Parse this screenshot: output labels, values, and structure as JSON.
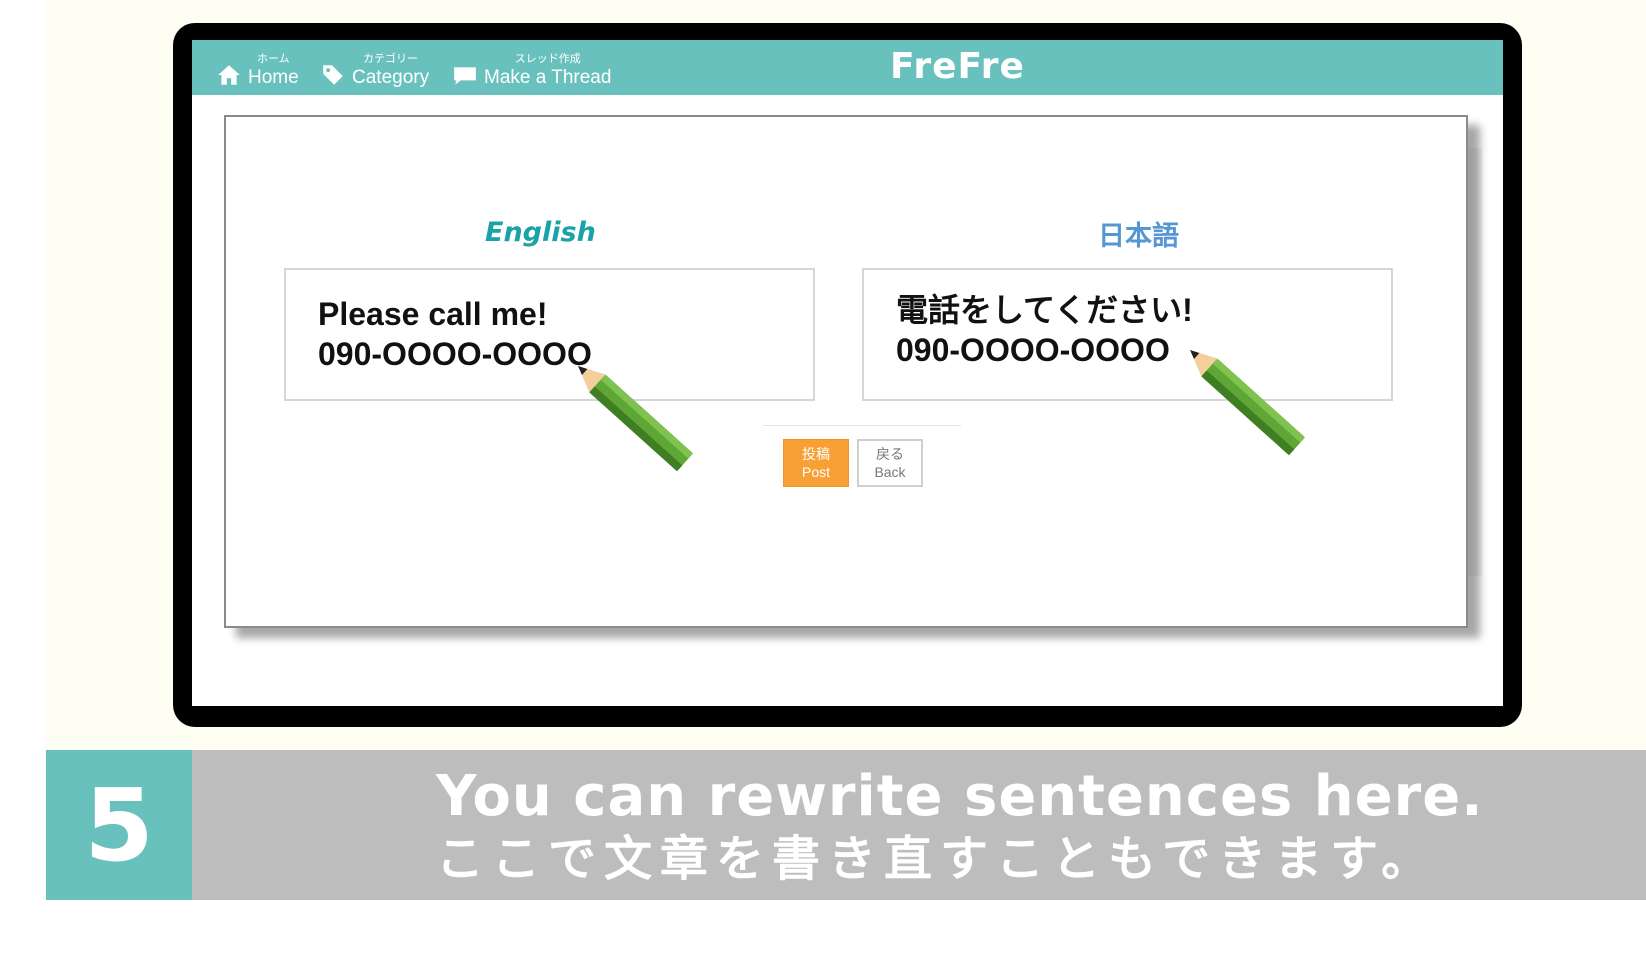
{
  "nav": {
    "home": {
      "jp": "ホーム",
      "en": "Home",
      "icon": "home-icon"
    },
    "category": {
      "jp": "カテゴリー",
      "en": "Category",
      "icon": "tag-icon"
    },
    "make_thread": {
      "jp": "スレッド作成",
      "en": "Make a Thread",
      "icon": "chat-bubble-icon"
    },
    "brand": "FreFre",
    "color": "#68c1bd"
  },
  "editor": {
    "english_label": "English",
    "japanese_label": "日本語",
    "english_text": {
      "line1": "Please call me!",
      "line2": "090-OOOO-OOOO"
    },
    "japanese_text": {
      "line1": "電話をしてください!",
      "line2": "090-OOOO-OOOO"
    }
  },
  "buttons": {
    "post": {
      "jp": "投稿",
      "en": "Post",
      "color": "#f7a035"
    },
    "back": {
      "jp": "戻る",
      "en": "Back"
    }
  },
  "caption": {
    "step": "5",
    "line1": "You can rewrite sentences here.",
    "line2": "ここで文章を書き直すこともできます。"
  }
}
